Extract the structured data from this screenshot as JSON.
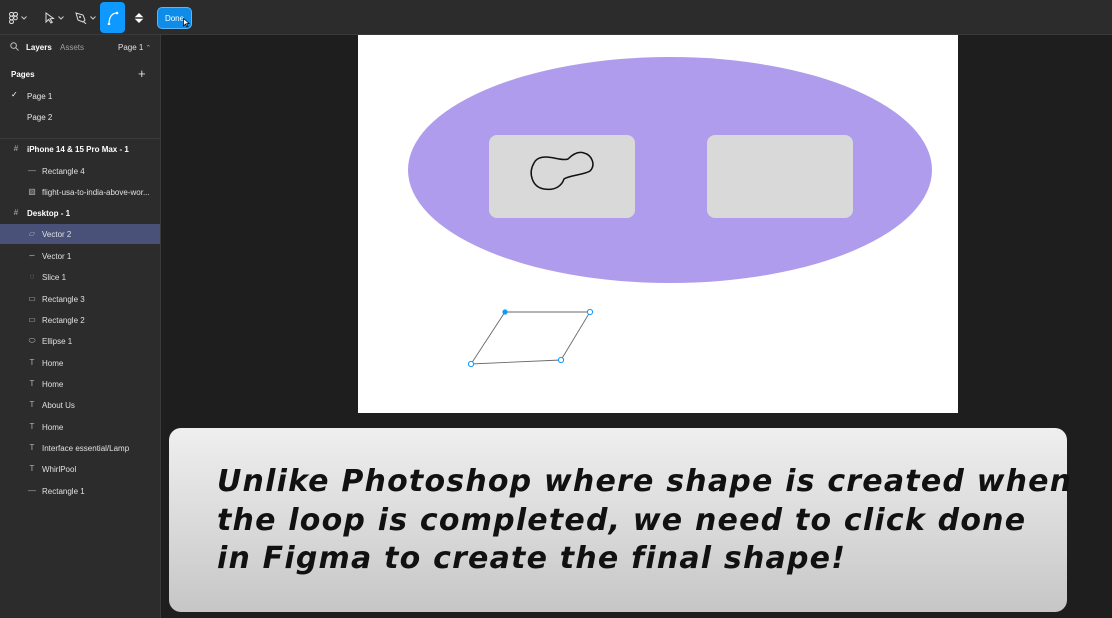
{
  "toolbar": {
    "done_label": "Done"
  },
  "sidebar": {
    "tabs": {
      "layers": "Layers",
      "assets": "Assets"
    },
    "page_select": "Page 1",
    "pages_heading": "Pages",
    "pages": [
      {
        "label": "Page 1",
        "current": true
      },
      {
        "label": "Page 2",
        "current": false
      }
    ],
    "layers": [
      {
        "label": "iPhone 14 & 15 Pro Max - 1",
        "icon": "frame-icon"
      },
      {
        "label": "Rectangle 4",
        "icon": "line-icon"
      },
      {
        "label": "flight-usa-to-india-above-wor...",
        "icon": "image-icon"
      },
      {
        "label": "Desktop - 1",
        "icon": "frame-icon"
      },
      {
        "label": "Vector 2",
        "icon": "vector-icon",
        "selected": true
      },
      {
        "label": "Vector 1",
        "icon": "vector-icon"
      },
      {
        "label": "Slice 1",
        "icon": "slice-icon"
      },
      {
        "label": "Rectangle 3",
        "icon": "rectangle-icon"
      },
      {
        "label": "Rectangle 2",
        "icon": "rectangle-icon"
      },
      {
        "label": "Ellipse 1",
        "icon": "ellipse-icon"
      },
      {
        "label": "Home",
        "icon": "text-icon"
      },
      {
        "label": "Home",
        "icon": "text-icon"
      },
      {
        "label": "About Us",
        "icon": "text-icon"
      },
      {
        "label": "Home",
        "icon": "text-icon"
      },
      {
        "label": "Interface essential/Lamp",
        "icon": "text-icon"
      },
      {
        "label": "WhirlPool",
        "icon": "text-icon"
      },
      {
        "label": "Rectangle 1",
        "icon": "line-icon"
      }
    ]
  },
  "canvas": {
    "ellipse_color": "#b09cec",
    "rect_color": "#d9d9d9",
    "accent": "#0d99ff"
  },
  "caption": {
    "line1": "Unlike Photoshop where shape  is created when",
    "line2": "the loop is completed, we need to click done",
    "line3": "in Figma to create the final shape!"
  }
}
